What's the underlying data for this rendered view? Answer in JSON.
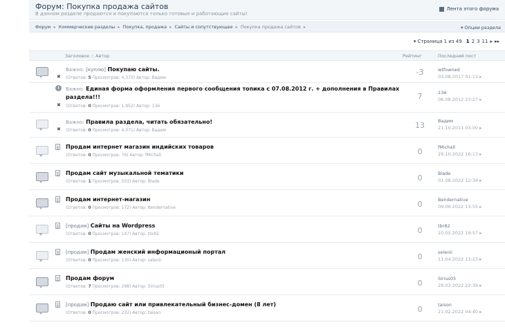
{
  "header": {
    "title": "Форум: Покупка продажа сайтов",
    "description": "В данном разделе продаются и покупаются только готовые и работающие сайты!",
    "rss_label": "Лента этого форума"
  },
  "breadcrumb": {
    "items": [
      "Форум",
      "Коммерческие разделы",
      "Покупка, продажа",
      "Сайты и сопутствующее",
      "Покупка продажа сайтов"
    ],
    "options_label": "▾ Опции раздела"
  },
  "pagination": {
    "label": "▾ Страница 1 из 49",
    "current": "1",
    "pages": [
      "2",
      "3",
      "11"
    ],
    "next": "▸",
    "last": "▸▸"
  },
  "columns": {
    "title_author": "Заголовок :: Автор",
    "rating": "Рейтинг",
    "last_post": "Последний пост"
  },
  "meta_labels": {
    "replies": "(Ответов:",
    "views": "Просмотров:",
    "author": "Автор:"
  },
  "topics": [
    {
      "prefix": "Важно:",
      "tag": "[куплю]",
      "title": "Покупаю сайты.",
      "replies": "5",
      "views": "4,370",
      "author": "Вадим",
      "rating": "-3",
      "last_user": "wtfowned",
      "last_date": "03.08.2017 01:13 ▸"
    },
    {
      "prefix": "Важно:",
      "tag": "",
      "title": "Единая форма оформления первого сообщения топика с 07.08.2012 г. + дополнения в Правилах раздела!!!",
      "replies": "0",
      "views": "1,952",
      "author": "13й",
      "rating": "7",
      "last_user": "13й",
      "last_date": "06.08.2012 23:27 ▸"
    },
    {
      "prefix": "Важно:",
      "tag": "",
      "title": "Правила раздела, читать обязательно!",
      "replies": "0",
      "views": "4,071",
      "author": "Вадим",
      "rating": "13",
      "last_user": "Вадим",
      "last_date": "21.10.2011 03:00 ▸"
    },
    {
      "prefix": "",
      "tag": "",
      "title": "Продам интернет магазин индийских товаров",
      "replies": "0",
      "views": "76",
      "author": "fMichall",
      "rating": "0",
      "last_user": "fMichall",
      "last_date": "29.10.2022 16:13 ▸"
    },
    {
      "prefix": "",
      "tag": "",
      "title": "Продам сайт музыкальной тематики",
      "replies": "1",
      "views": "503",
      "author": "Blade",
      "rating": "0",
      "last_user": "Blade",
      "last_date": "01.08.2022 12:34 ▸"
    },
    {
      "prefix": "",
      "tag": "",
      "title": "Продам интернет-магазин",
      "replies": "0",
      "views": "172",
      "author": "Bendernative",
      "rating": "0",
      "last_user": "Bendernative",
      "last_date": "09.06.2022 13:55 ▸"
    },
    {
      "prefix": "",
      "tag": "[продам]",
      "title": "Сайты на Wordpress",
      "replies": "0",
      "views": "147",
      "author": "tbr82",
      "rating": "0",
      "last_user": "tbr82",
      "last_date": "10.05.2022 19:57 ▸"
    },
    {
      "prefix": "",
      "tag": "[продам]",
      "title": "Продам женский информационый портал",
      "replies": "0",
      "views": "130",
      "author": "selenii",
      "rating": "0",
      "last_user": "selenii",
      "last_date": "11.04.2022 13:23 ▸"
    },
    {
      "prefix": "",
      "tag": "",
      "title": "Продам форум",
      "replies": "7",
      "views": "298",
      "author": "Sirius05",
      "rating": "0",
      "last_user": "Sirius05",
      "last_date": "29.03.2022 22:39 ▸"
    },
    {
      "prefix": "",
      "tag": "[продам]",
      "title": "Продаю сайт или привлекательный бизнес-домен (8 лет)",
      "replies": "0",
      "views": "232",
      "author": "taison",
      "rating": "0",
      "last_user": "taison",
      "last_date": "21.02.2022 04:40 ▸"
    }
  ]
}
